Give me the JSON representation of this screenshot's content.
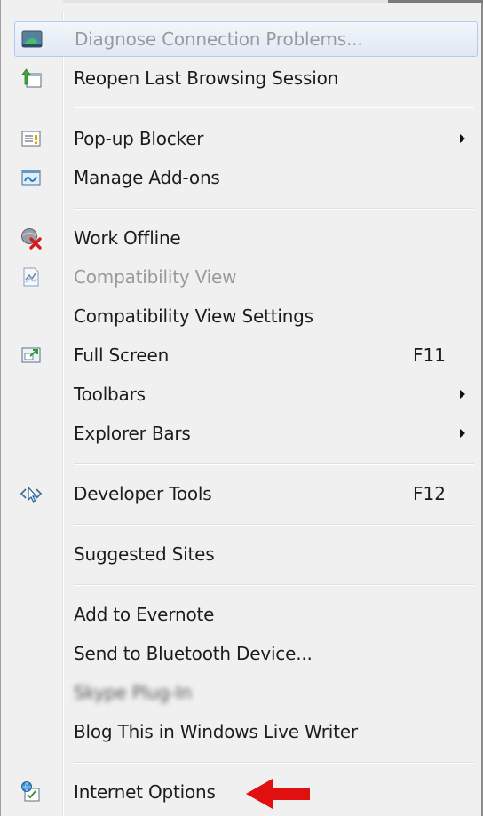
{
  "menu": {
    "items": [
      {
        "label": "Diagnose Connection Problems...",
        "icon": "diagnose-connection-icon",
        "disabled": true,
        "hover": true
      },
      {
        "label": "Reopen Last Browsing Session",
        "icon": "reopen-session-icon"
      },
      {
        "label": "Pop-up Blocker",
        "icon": "popup-blocker-icon",
        "submenu": true
      },
      {
        "label": "Manage Add-ons",
        "icon": "manage-addons-icon"
      },
      {
        "label": "Work Offline",
        "icon": "work-offline-icon"
      },
      {
        "label": "Compatibility View",
        "icon": "compatibility-view-icon",
        "disabled": true
      },
      {
        "label": "Compatibility View Settings"
      },
      {
        "label": "Full Screen",
        "icon": "full-screen-icon",
        "shortcut": "F11"
      },
      {
        "label": "Toolbars",
        "submenu": true
      },
      {
        "label": "Explorer Bars",
        "submenu": true
      },
      {
        "label": "Developer Tools",
        "icon": "developer-tools-icon",
        "shortcut": "F12"
      },
      {
        "label": "Suggested Sites"
      },
      {
        "label": "Add to Evernote"
      },
      {
        "label": "Send to Bluetooth Device..."
      },
      {
        "label": "Skype Plug-In",
        "blurred": true
      },
      {
        "label": "Blog This in Windows Live Writer"
      },
      {
        "label": "Internet Options",
        "icon": "internet-options-icon"
      }
    ]
  },
  "annotation": {
    "arrow_color": "#e01010",
    "arrow_icon": "red-arrow-icon"
  }
}
